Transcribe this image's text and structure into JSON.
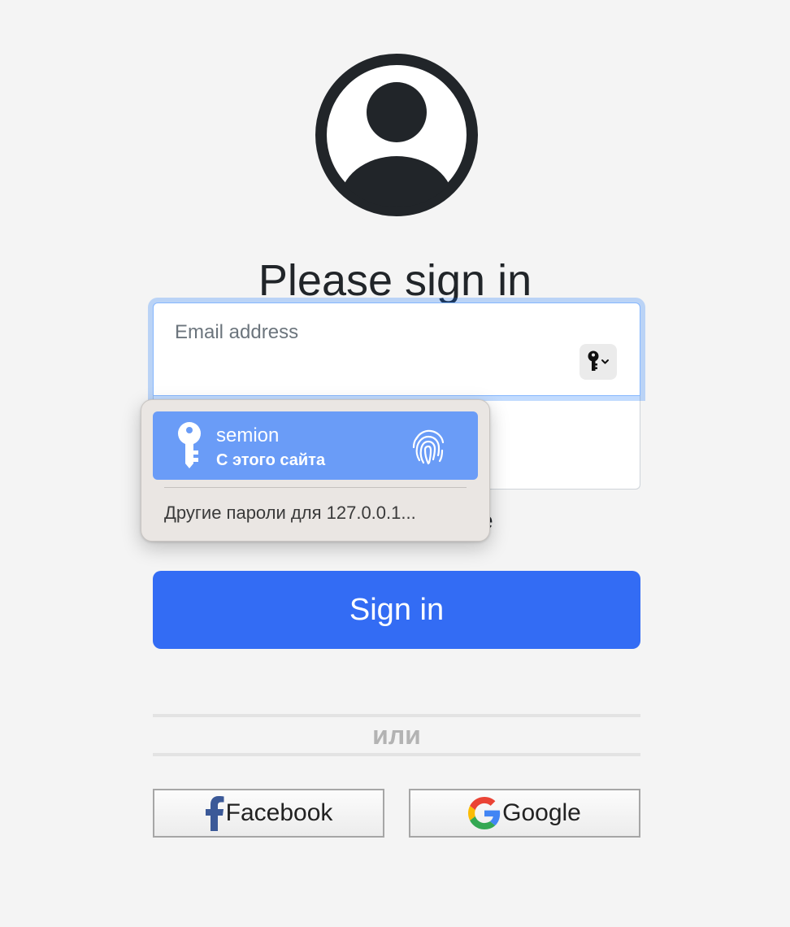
{
  "heading": "Please sign in",
  "form": {
    "email_label": "Email address",
    "remember_fragment": "e",
    "signin_label": "Sign in"
  },
  "divider": {
    "text": "или"
  },
  "social": {
    "facebook_label": "Facebook",
    "google_label": "Google"
  },
  "autofill": {
    "username": "semion",
    "source": "С этого сайта",
    "other_passwords": "Другие пароли для 127.0.0.1..."
  },
  "icons": {
    "avatar": "user-circle-icon",
    "key_button": "key-icon",
    "suggestion_key": "key-icon",
    "fingerprint": "fingerprint-icon",
    "facebook": "facebook-icon",
    "google": "google-icon"
  },
  "colors": {
    "primary": "#336cf4",
    "suggestion_highlight": "#6a9cf7",
    "focus_border": "#86b7fe",
    "divider_text": "#b3b3b3"
  }
}
